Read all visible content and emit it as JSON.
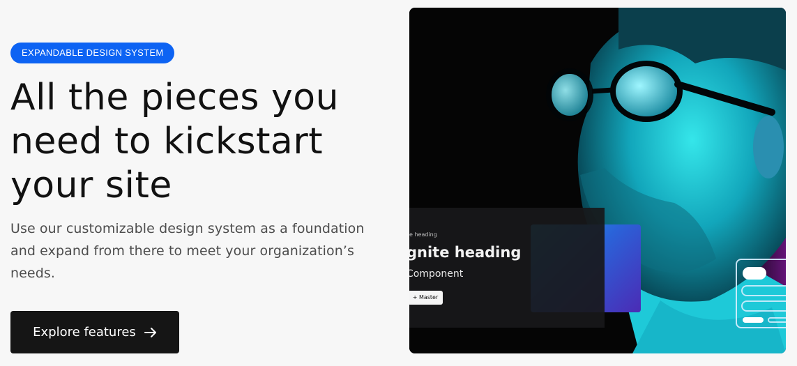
{
  "hero_section": {
    "eyebrow": "EXPANDABLE DESIGN SYSTEM",
    "headline": "All the pieces you need to kickstart your site",
    "lead": "Use our customizable design system as a foundation and expand from there to meet your organization’s needs.",
    "cta_label": "Explore features",
    "cta_icon": "arrow-right-icon"
  },
  "hero_image": {
    "description_icon": "portrait-photo",
    "mock_card": {
      "eyebrow": "e heading",
      "heading": "gnite heading",
      "subheading": "Component",
      "button_label": "+ Master"
    }
  },
  "colors": {
    "accent": "#0d63f3",
    "cta_bg": "#151515",
    "page_bg": "#f7f7f7",
    "headline": "#111111",
    "body_text": "#4d4d4d"
  }
}
